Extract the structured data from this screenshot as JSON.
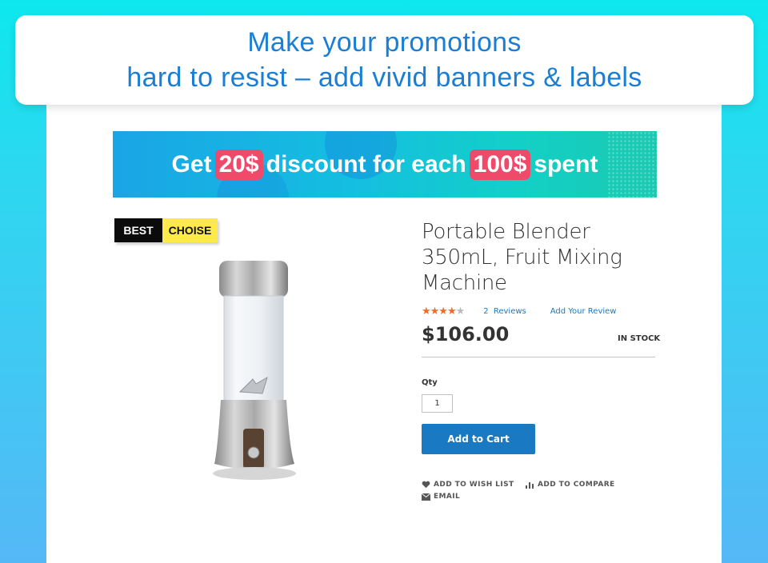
{
  "headline": {
    "line1": "Make your promotions",
    "line2": "hard to resist – add vivid banners & labels"
  },
  "banner": {
    "part1": "Get",
    "highlight1": "20$",
    "part2": "discount for each",
    "highlight2": "100$",
    "part3": "spent",
    "highlight_color": "#f04a6a"
  },
  "label": {
    "black_text": "BEST",
    "yellow_text": "CHOISE"
  },
  "product": {
    "title": "Portable Blender 350mL, Fruit Mixing Machine",
    "rating": 4.5,
    "reviews_count": "2",
    "reviews_label": "Reviews",
    "add_review": "Add Your Review",
    "price": "$106.00",
    "stock": "IN STOCK",
    "qty_label": "Qty",
    "qty_value": "1",
    "add_to_cart": "Add to Cart",
    "wishlist": "ADD TO WISH LIST",
    "compare": "ADD TO COMPARE",
    "email": "EMAIL"
  },
  "colors": {
    "accent": "#1979c3",
    "star": "#f26b2a",
    "headline": "#1a7fd4"
  }
}
